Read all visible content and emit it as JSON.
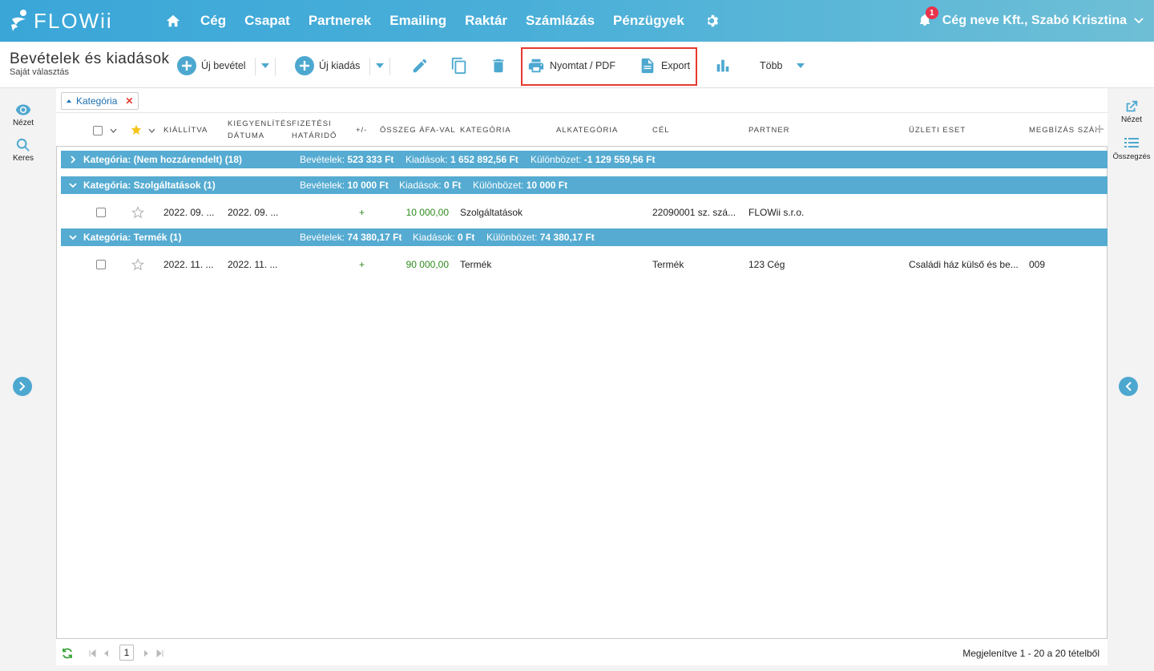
{
  "app": {
    "name": "FLOWii"
  },
  "nav": {
    "items": [
      "Cég",
      "Csapat",
      "Partnerek",
      "Emailing",
      "Raktár",
      "Számlázás",
      "Pénzügyek"
    ],
    "notification_count": "1",
    "user_label": "Cég neve Kft., Szabó Krisztina"
  },
  "toolbar": {
    "title": "Bevételek és kiadások",
    "subtitle": "Saját választás",
    "new_income": "Új bevétel",
    "new_expense": "Új kiadás",
    "print_pdf": "Nyomtat / PDF",
    "export": "Export",
    "more": "Több"
  },
  "left_sidebar": {
    "view": "Nézet",
    "search": "Keres"
  },
  "right_sidebar": {
    "view": "Nézet",
    "summary": "Összegzés"
  },
  "filter": {
    "chip_label": "Kategória"
  },
  "columns": {
    "issued": "KIÁLLÍTVA",
    "settlement_1": "KIEGYENLÍTÉS",
    "settlement_2": "DÁTUMA",
    "due_1": "FIZETÉSI",
    "due_2": "HATÁRIDŐ",
    "sign": "+/-",
    "amount": "ÖSSZEG ÁFA-VAL",
    "category": "KATEGÓRIA",
    "subcategory": "ALKATEGÓRIA",
    "goal": "CÉL",
    "partner": "PARTNER",
    "business_case": "ÜZLETI ESET",
    "order_number": "MEGBÍZÁS SZÁM"
  },
  "groups": [
    {
      "label": "Kategória: (Nem hozzárendelt) (18)",
      "income_label": "Bevételek:",
      "income": "523 333 Ft",
      "expense_label": "Kiadások:",
      "expense": "1 652 892,56 Ft",
      "diff_label": "Különbözet:",
      "diff": "-1 129 559,56 Ft"
    },
    {
      "label": "Kategória: Szolgáltatások (1)",
      "income_label": "Bevételek:",
      "income": "10 000 Ft",
      "expense_label": "Kiadások:",
      "expense": "0 Ft",
      "diff_label": "Különbözet:",
      "diff": "10 000 Ft"
    },
    {
      "label": "Kategória: Termék (1)",
      "income_label": "Bevételek:",
      "income": "74 380,17 Ft",
      "expense_label": "Kiadások:",
      "expense": "0 Ft",
      "diff_label": "Különbözet:",
      "diff": "74 380,17 Ft"
    }
  ],
  "rows": [
    {
      "issued": "2022. 09. ...",
      "settlement": "2022. 09. ...",
      "sign": "+",
      "amount": "10 000,00",
      "category": "Szolgáltatások",
      "goal": "22090001 sz. szá...",
      "partner": "FLOWii s.r.o.",
      "business_case": "",
      "order_number": ""
    },
    {
      "issued": "2022. 11. ...",
      "settlement": "2022. 11. ...",
      "sign": "+",
      "amount": "90 000,00",
      "category": "Termék",
      "goal": "Termék",
      "partner": "123 Cég",
      "business_case": "Családi ház külső és be...",
      "order_number": "009"
    }
  ],
  "footer": {
    "page": "1",
    "summary": "Megjelenítve 1 - 20 a 20 tételből"
  },
  "colors": {
    "accent": "#4da8d0",
    "group_bg": "#55abd1",
    "highlight": "#e53a2f",
    "positive": "#2e8b1e"
  }
}
